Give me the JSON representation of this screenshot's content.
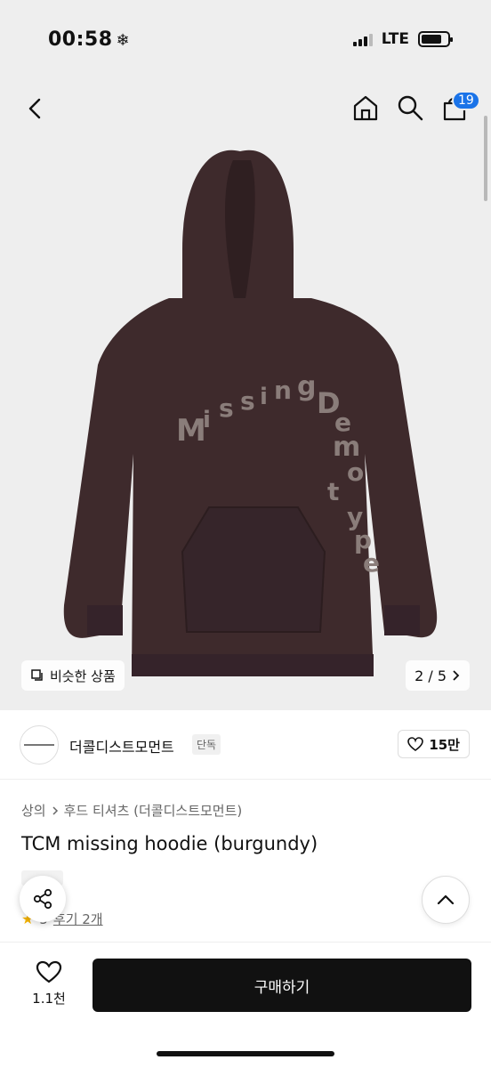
{
  "status_bar": {
    "time": "00:58",
    "time_icon": "snowflake-icon",
    "network": "LTE"
  },
  "nav": {
    "cart_count": "19",
    "icons": [
      "back-arrow-icon",
      "home-icon",
      "search-icon",
      "cart-icon"
    ]
  },
  "hero": {
    "hoodie_print": [
      "M",
      "i",
      "s",
      "s",
      "i",
      "n",
      "g",
      "D",
      "e",
      "m",
      "o",
      "t",
      "y",
      "p",
      "e"
    ],
    "similar_label": "비슷한 상품",
    "pager_label": "2 / 5",
    "pager_current": 2,
    "pager_total": 5
  },
  "shop": {
    "name": "더콜디스트모먼트",
    "tag": "단독",
    "like_count": "15만"
  },
  "product": {
    "breadcrumb_category": "상의",
    "breadcrumb_sub": "후드 티셔츠 (더콜디스트모먼트)",
    "title": "TCM missing hoodie (burgundy)",
    "review_score": "5",
    "review_link": "후기 2개"
  },
  "bottom": {
    "wish_count": "1.1천",
    "buy_label": "구매하기"
  },
  "colors": {
    "hoodie": "#3e2a2c",
    "print": "#8a7d7a",
    "badge": "#1a73e8",
    "buy_button": "#111111"
  }
}
